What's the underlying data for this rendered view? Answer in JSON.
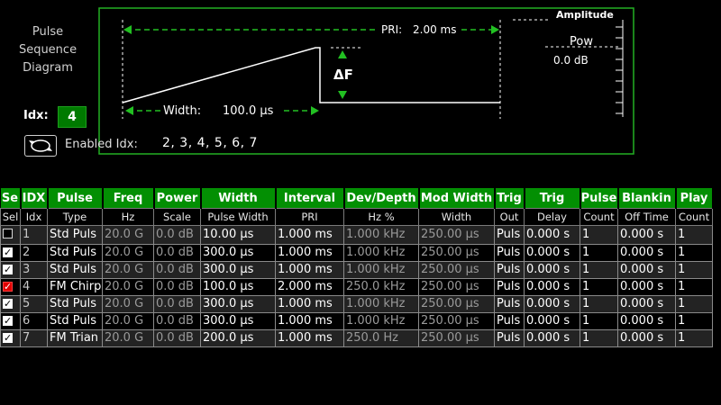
{
  "diagram": {
    "title": "Pulse\nSequence\nDiagram",
    "pri_label": "PRI:",
    "pri_value": "2.00 ms",
    "width_label": "Width:",
    "width_value": "100.0 µs",
    "delta_label": "ΔF",
    "amplitude_label": "Amplitude",
    "pow_label": "Pow",
    "pow_value": "0.0 dB"
  },
  "index": {
    "label": "Idx:",
    "value": "4"
  },
  "enabled": {
    "label": "Enabled Idx:",
    "value": "2, 3, 4, 5, 6, 7"
  },
  "table": {
    "headers": [
      "Se",
      "IDX",
      "Pulse",
      "Freq",
      "Power",
      "Width",
      "Interval",
      "Dev/Depth",
      "Mod Width",
      "Trig",
      "Trig",
      "Pulse",
      "Blankin",
      "Play"
    ],
    "subheaders": [
      "Sel",
      "Idx",
      "Type",
      "Hz",
      "Scale",
      "Pulse Width",
      "PRI",
      "Hz %",
      "Width",
      "Out",
      "Delay",
      "Count",
      "Off Time",
      "Count"
    ],
    "rows": [
      {
        "sel": "off",
        "idx": "1",
        "type": "Std Puls",
        "freq": "20.0 G",
        "power": "0.0 dB",
        "width": "10.00 µs",
        "pri": "1.000 ms",
        "dev": "1.000 kHz",
        "mod": "250.00 µs",
        "trigout": "Puls",
        "delay": "0.000 s",
        "count": "1",
        "off": "0.000 s",
        "play": "1"
      },
      {
        "sel": "on",
        "idx": "2",
        "type": "Std Puls",
        "freq": "20.0 G",
        "power": "0.0 dB",
        "width": "300.0 µs",
        "pri": "1.000 ms",
        "dev": "1.000 kHz",
        "mod": "250.00 µs",
        "trigout": "Puls",
        "delay": "0.000 s",
        "count": "1",
        "off": "0.000 s",
        "play": "1"
      },
      {
        "sel": "on",
        "idx": "3",
        "type": "Std Puls",
        "freq": "20.0 G",
        "power": "0.0 dB",
        "width": "300.0 µs",
        "pri": "1.000 ms",
        "dev": "1.000 kHz",
        "mod": "250.00 µs",
        "trigout": "Puls",
        "delay": "0.000 s",
        "count": "1",
        "off": "0.000 s",
        "play": "1"
      },
      {
        "sel": "active",
        "idx": "4",
        "type": "FM Chirp",
        "freq": "20.0 G",
        "power": "0.0 dB",
        "width": "100.0 µs",
        "pri": "2.000 ms",
        "dev": "250.0 kHz",
        "mod": "250.00 µs",
        "trigout": "Puls",
        "delay": "0.000 s",
        "count": "1",
        "off": "0.000 s",
        "play": "1"
      },
      {
        "sel": "on",
        "idx": "5",
        "type": "Std Puls",
        "freq": "20.0 G",
        "power": "0.0 dB",
        "width": "300.0 µs",
        "pri": "1.000 ms",
        "dev": "1.000 kHz",
        "mod": "250.00 µs",
        "trigout": "Puls",
        "delay": "0.000 s",
        "count": "1",
        "off": "0.000 s",
        "play": "1"
      },
      {
        "sel": "on",
        "idx": "6",
        "type": "Std Puls",
        "freq": "20.0 G",
        "power": "0.0 dB",
        "width": "300.0 µs",
        "pri": "1.000 ms",
        "dev": "1.000 kHz",
        "mod": "250.00 µs",
        "trigout": "Puls",
        "delay": "0.000 s",
        "count": "1",
        "off": "0.000 s",
        "play": "1"
      },
      {
        "sel": "on",
        "idx": "7",
        "type": "FM Trian",
        "freq": "20.0 G",
        "power": "0.0 dB",
        "width": "200.0 µs",
        "pri": "1.000 ms",
        "dev": "250.0 Hz",
        "mod": "250.00 µs",
        "trigout": "Puls",
        "delay": "0.000 s",
        "count": "1",
        "off": "0.000 s",
        "play": "1"
      }
    ]
  },
  "colors": {
    "accent_green": "#038f03",
    "dashed_green": "#22c022",
    "selected_red": "#e00000"
  }
}
